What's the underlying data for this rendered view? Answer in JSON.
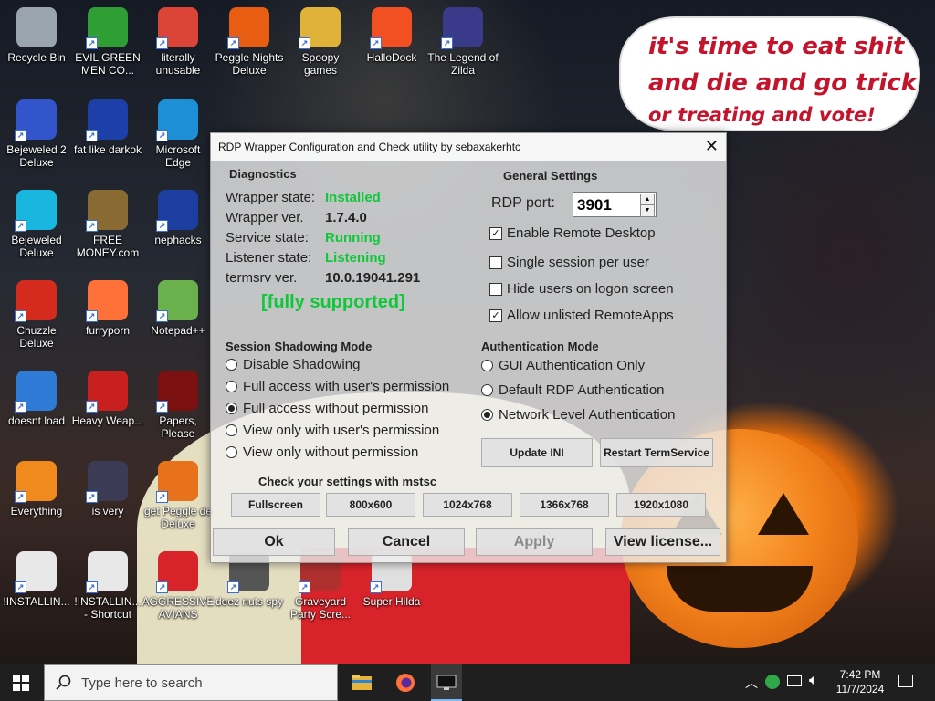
{
  "desktop": {
    "icons": [
      {
        "label": "Recycle Bin",
        "icon": "recycle-bin-icon",
        "color": "#9aa4ad"
      },
      {
        "label": "EVIL GREEN MEN CO...",
        "icon": "green-people-icon",
        "color": "#2f9e35"
      },
      {
        "label": "literally unusable",
        "icon": "chrome-icon",
        "color": "#db4437"
      },
      {
        "label": "Peggle Nights Deluxe",
        "icon": "peggle-icon",
        "color": "#e85d12"
      },
      {
        "label": "Spoopy games",
        "icon": "folder-icon",
        "color": "#e0b23a"
      },
      {
        "label": "HalloDock",
        "icon": "windows-logo-icon",
        "color": "#f25022"
      },
      {
        "label": "The Legend of Zilda",
        "icon": "zilda-icon",
        "color": "#3a3a8a"
      },
      {
        "label": "Bejeweled 2 Deluxe",
        "icon": "bejeweled-2-icon",
        "color": "#3355cc"
      },
      {
        "label": "fat like darkok",
        "icon": "mpl-icon",
        "color": "#1d3fa8"
      },
      {
        "label": "Microsoft Edge",
        "icon": "edge-icon",
        "color": "#1c8fd6"
      },
      {
        "label": "Bejeweled Deluxe",
        "icon": "gem-icon",
        "color": "#19b6e0"
      },
      {
        "label": "FREE MONEY.com",
        "icon": "money-bag-icon",
        "color": "#8a6a33"
      },
      {
        "label": "nephacks",
        "icon": "mpi-icon",
        "color": "#1b3ea0"
      },
      {
        "label": "Chuzzle Deluxe",
        "icon": "chuzzle-icon",
        "color": "#d52b1e"
      },
      {
        "label": "furryporn",
        "icon": "firefox-icon",
        "color": "#ff7139"
      },
      {
        "label": "Notepad++",
        "icon": "notepad-plus-plus-icon",
        "color": "#6ab04c"
      },
      {
        "label": "doesnt load",
        "icon": "thunderbird-icon",
        "color": "#2e7bd6"
      },
      {
        "label": "Heavy Weap...",
        "icon": "radiation-icon",
        "color": "#c8201e"
      },
      {
        "label": "Papers, Please",
        "icon": "papers-please-icon",
        "color": "#7a1010"
      },
      {
        "label": "Everything",
        "icon": "magnifier-icon",
        "color": "#f08a1c"
      },
      {
        "label": "is very",
        "icon": "mpl-shield-icon",
        "color": "#3b3b55"
      },
      {
        "label": "get Peggle de Deluxe",
        "icon": "peggle-deluxe-icon",
        "color": "#e8711c"
      },
      {
        "label": "!INSTALLIN...",
        "icon": "text-file-icon",
        "color": "#e8e8e8"
      },
      {
        "label": "!INSTALLIN... - Shortcut",
        "icon": "text-file-shortcut-icon",
        "color": "#e8e8e8"
      },
      {
        "label": "AGGRESSIVE AVIANS",
        "icon": "angry-bird-icon",
        "color": "#d8232a"
      },
      {
        "label": "deez nuts spy",
        "icon": "screen-icon",
        "color": "#555555"
      },
      {
        "label": "Graveyard Party Scre...",
        "icon": "graveyard-icon",
        "color": "#b03030"
      },
      {
        "label": "Super Hilda",
        "icon": "super-hilda-icon",
        "color": "#e0e0e0"
      }
    ],
    "bubble_lines": [
      "it's time to eat shit",
      "and die and go trick",
      "or treating and vote!"
    ]
  },
  "rdp_window": {
    "title": "RDP Wrapper Configuration and Check utility by sebaxakerhtc",
    "diagnostics": {
      "heading": "Diagnostics",
      "rows": [
        {
          "label": "Wrapper state:",
          "value": "Installed"
        },
        {
          "label": "Wrapper ver.",
          "value": "1.7.4.0"
        },
        {
          "label": "Service state:",
          "value": "Running"
        },
        {
          "label": "Listener state:",
          "value": "Listening"
        },
        {
          "label": "termsrv ver.",
          "value": "10.0.19041.291"
        }
      ],
      "support_status": "[fully supported]"
    },
    "general_settings": {
      "heading": "General Settings",
      "rdp_port_label": "RDP port:",
      "rdp_port_value": "3901",
      "checkboxes": [
        {
          "label": "Enable Remote Desktop",
          "checked": true
        },
        {
          "label": "Single session per user",
          "checked": false
        },
        {
          "label": "Hide users on logon screen",
          "checked": false
        },
        {
          "label": "Allow unlisted RemoteApps",
          "checked": true
        }
      ]
    },
    "shadowing": {
      "heading": "Session Shadowing Mode",
      "options": [
        {
          "label": "Disable Shadowing",
          "selected": false
        },
        {
          "label": "Full access with user's permission",
          "selected": false
        },
        {
          "label": "Full access without permission",
          "selected": true
        },
        {
          "label": "View only with user's permission",
          "selected": false
        },
        {
          "label": "View only without permission",
          "selected": false
        }
      ]
    },
    "authentication": {
      "heading": "Authentication Mode",
      "options": [
        {
          "label": "GUI Authentication Only",
          "selected": false
        },
        {
          "label": "Default RDP Authentication",
          "selected": false
        },
        {
          "label": "Network Level Authentication",
          "selected": true
        }
      ]
    },
    "update_ini_label": "Update INI",
    "restart_label": "Restart TermService",
    "check_heading": "Check your settings with mstsc",
    "resolutions": [
      "Fullscreen",
      "800x600",
      "1024x768",
      "1366x768",
      "1920x1080"
    ],
    "ok_label": "Ok",
    "cancel_label": "Cancel",
    "apply_label": "Apply",
    "license_label": "View license..."
  },
  "taskbar": {
    "search_placeholder": "Type here to search",
    "time": "7:42 PM",
    "date": "11/7/2024"
  },
  "colors": {
    "status_green": "#0fc83a",
    "taskbar": "#1f1f1f",
    "bubble_text": "#c4142c"
  }
}
